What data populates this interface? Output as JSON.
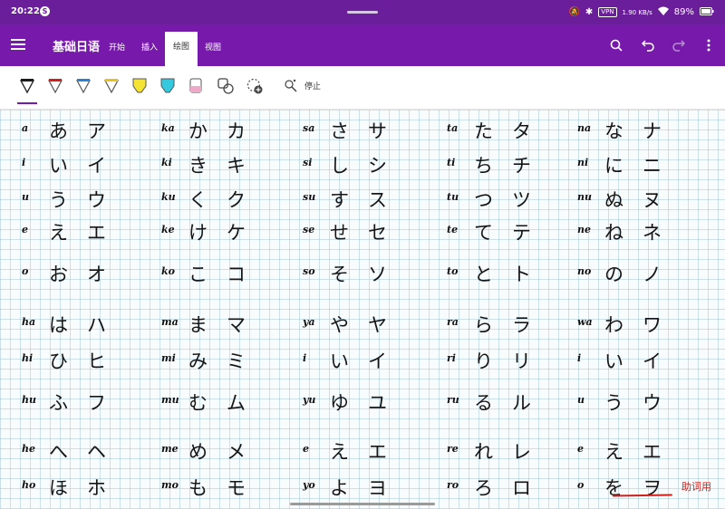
{
  "status": {
    "time": "20:22",
    "network_chip": "VPN",
    "speed": "1.90 KB/s",
    "battery": "89%"
  },
  "app": {
    "title": "基础日语"
  },
  "tabs": [
    {
      "label": "开始",
      "active": false
    },
    {
      "label": "插入",
      "active": false
    },
    {
      "label": "绘图",
      "active": true
    },
    {
      "label": "视图",
      "active": false
    }
  ],
  "toolbar": {
    "stop_label": "停止",
    "pens": [
      {
        "name": "black-pen",
        "color": "#1b1b1b"
      },
      {
        "name": "red-pen",
        "color": "#d0201c"
      },
      {
        "name": "blue-pen",
        "color": "#2f7fd1"
      },
      {
        "name": "yellow-pen",
        "color": "#e8c21c"
      },
      {
        "name": "yellow-highlighter",
        "color": "#f4e334"
      },
      {
        "name": "cyan-highlighter",
        "color": "#35c9e0"
      },
      {
        "name": "pink-highlighter",
        "color": "#f0a8c8"
      }
    ]
  },
  "kana_columns": [
    {
      "rows": [
        {
          "romaji": "a",
          "hira": "あ",
          "kata": "ア"
        },
        {
          "romaji": "i",
          "hira": "い",
          "kata": "イ"
        },
        {
          "romaji": "u",
          "hira": "う",
          "kata": "ウ"
        },
        {
          "romaji": "e",
          "hira": "え",
          "kata": "エ"
        },
        {
          "romaji": "o",
          "hira": "お",
          "kata": "オ"
        },
        {
          "romaji": "ha",
          "hira": "は",
          "kata": "ハ"
        },
        {
          "romaji": "hi",
          "hira": "ひ",
          "kata": "ヒ"
        },
        {
          "romaji": "hu",
          "hira": "ふ",
          "kata": "フ"
        },
        {
          "romaji": "he",
          "hira": "へ",
          "kata": "ヘ"
        },
        {
          "romaji": "ho",
          "hira": "ほ",
          "kata": "ホ"
        }
      ]
    },
    {
      "rows": [
        {
          "romaji": "ka",
          "hira": "か",
          "kata": "カ"
        },
        {
          "romaji": "ki",
          "hira": "き",
          "kata": "キ"
        },
        {
          "romaji": "ku",
          "hira": "く",
          "kata": "ク"
        },
        {
          "romaji": "ke",
          "hira": "け",
          "kata": "ケ"
        },
        {
          "romaji": "ko",
          "hira": "こ",
          "kata": "コ"
        },
        {
          "romaji": "ma",
          "hira": "ま",
          "kata": "マ"
        },
        {
          "romaji": "mi",
          "hira": "み",
          "kata": "ミ"
        },
        {
          "romaji": "mu",
          "hira": "む",
          "kata": "ム"
        },
        {
          "romaji": "me",
          "hira": "め",
          "kata": "メ"
        },
        {
          "romaji": "mo",
          "hira": "も",
          "kata": "モ"
        }
      ]
    },
    {
      "rows": [
        {
          "romaji": "sa",
          "hira": "さ",
          "kata": "サ"
        },
        {
          "romaji": "si",
          "hira": "し",
          "kata": "シ"
        },
        {
          "romaji": "su",
          "hira": "す",
          "kata": "ス"
        },
        {
          "romaji": "se",
          "hira": "せ",
          "kata": "セ"
        },
        {
          "romaji": "so",
          "hira": "そ",
          "kata": "ソ"
        },
        {
          "romaji": "ya",
          "hira": "や",
          "kata": "ヤ"
        },
        {
          "romaji": "i",
          "hira": "い",
          "kata": "イ"
        },
        {
          "romaji": "yu",
          "hira": "ゆ",
          "kata": "ユ"
        },
        {
          "romaji": "e",
          "hira": "え",
          "kata": "エ"
        },
        {
          "romaji": "yo",
          "hira": "よ",
          "kata": "ヨ"
        }
      ]
    },
    {
      "rows": [
        {
          "romaji": "ta",
          "hira": "た",
          "kata": "タ"
        },
        {
          "romaji": "ti",
          "hira": "ち",
          "kata": "チ"
        },
        {
          "romaji": "tu",
          "hira": "つ",
          "kata": "ツ"
        },
        {
          "romaji": "te",
          "hira": "て",
          "kata": "テ"
        },
        {
          "romaji": "to",
          "hira": "と",
          "kata": "ト"
        },
        {
          "romaji": "ra",
          "hira": "ら",
          "kata": "ラ"
        },
        {
          "romaji": "ri",
          "hira": "り",
          "kata": "リ"
        },
        {
          "romaji": "ru",
          "hira": "る",
          "kata": "ル"
        },
        {
          "romaji": "re",
          "hira": "れ",
          "kata": "レ"
        },
        {
          "romaji": "ro",
          "hira": "ろ",
          "kata": "ロ"
        }
      ]
    },
    {
      "rows": [
        {
          "romaji": "na",
          "hira": "な",
          "kata": "ナ"
        },
        {
          "romaji": "ni",
          "hira": "に",
          "kata": "ニ"
        },
        {
          "romaji": "nu",
          "hira": "ぬ",
          "kata": "ヌ"
        },
        {
          "romaji": "ne",
          "hira": "ね",
          "kata": "ネ"
        },
        {
          "romaji": "no",
          "hira": "の",
          "kata": "ノ"
        },
        {
          "romaji": "wa",
          "hira": "わ",
          "kata": "ワ"
        },
        {
          "romaji": "i",
          "hira": "い",
          "kata": "イ"
        },
        {
          "romaji": "u",
          "hira": "う",
          "kata": "ウ"
        },
        {
          "romaji": "e",
          "hira": "え",
          "kata": "エ"
        },
        {
          "romaji": "o",
          "hira": "を",
          "kata": "ヲ"
        }
      ]
    }
  ],
  "annotation": {
    "note": "助词用",
    "color": "#d0201c"
  }
}
